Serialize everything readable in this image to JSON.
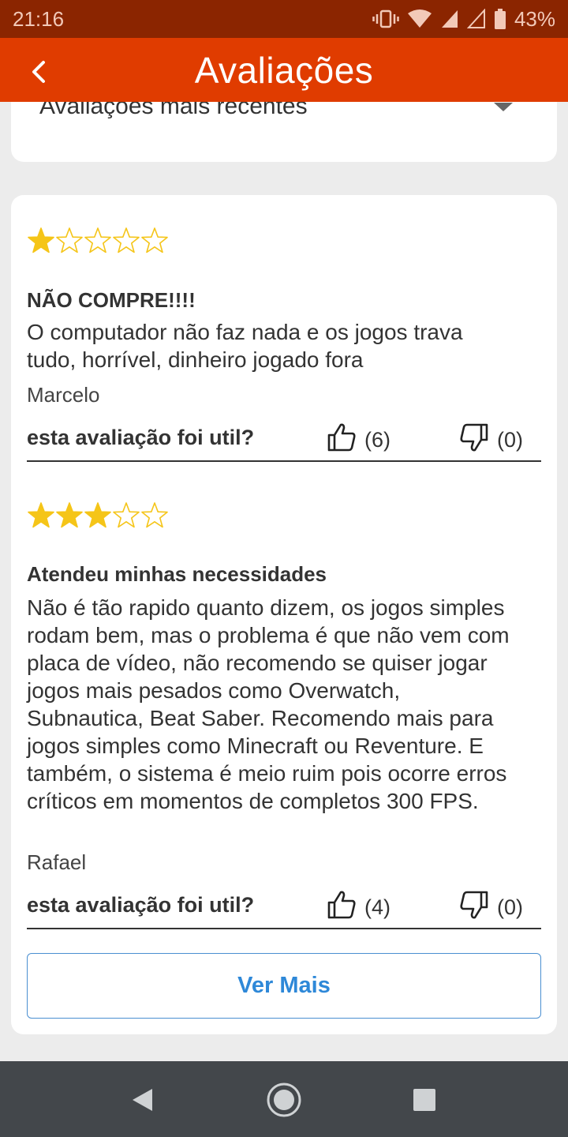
{
  "status_bar": {
    "time": "21:16",
    "battery_percent": "43%",
    "icons": [
      "vibrate-icon",
      "wifi-icon",
      "signal-icon",
      "signal-icon",
      "battery-icon"
    ]
  },
  "app_bar": {
    "title": "Avaliações",
    "back_icon": "chevron-left-icon"
  },
  "sort": {
    "selected": "Avaliações mais recentes"
  },
  "reviews": [
    {
      "rating": 1,
      "max_rating": 5,
      "title": "NÃO COMPRE!!!!",
      "body": "O computador não faz nada e os jogos trava tudo, horrível, dinheiro jogado fora",
      "author": "Marcelo",
      "helpful_question": "esta avaliação foi util?",
      "likes": "(6)",
      "dislikes": "(0)"
    },
    {
      "rating": 3,
      "max_rating": 5,
      "title": "Atendeu minhas necessidades",
      "body": "Não é tão rapido quanto dizem, os jogos simples rodam bem, mas o problema é que não vem com placa de vídeo, não recomendo se quiser jogar jogos mais pesados como Overwatch, Subnautica, Beat Saber. Recomendo mais para jogos simples como Minecraft ou Reventure. E também, o sistema é meio ruim pois ocorre erros críticos em momentos de completos 300 FPS.",
      "author": "Rafael",
      "helpful_question": "esta avaliação foi util?",
      "likes": "(4)",
      "dislikes": "(0)"
    }
  ],
  "more_button": "Ver Mais",
  "colors": {
    "status_bar": "#8b2500",
    "app_bar": "#e03c00",
    "star": "#f5c518",
    "link": "#2e88d8",
    "nav_bar": "#43474b"
  }
}
